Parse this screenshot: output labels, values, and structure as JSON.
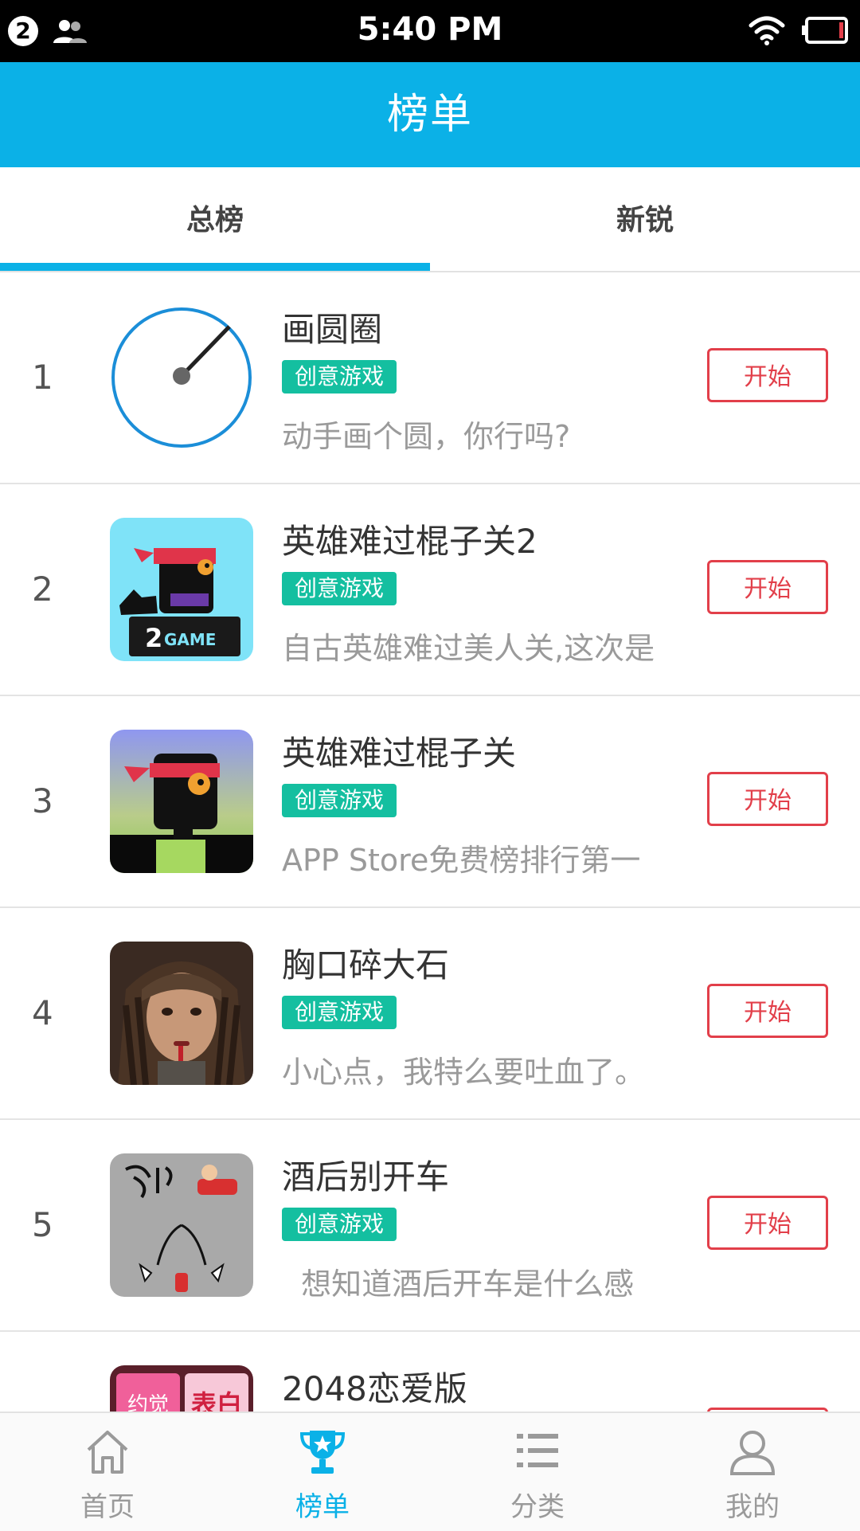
{
  "status_bar": {
    "notification_count": "2",
    "time": "5:40 PM"
  },
  "header": {
    "title": "榜单"
  },
  "tabs": [
    {
      "label": "总榜",
      "selected": true
    },
    {
      "label": "新锐",
      "selected": false
    }
  ],
  "games": [
    {
      "rank": "1",
      "title": "画圆圈",
      "tag": "创意游戏",
      "desc": "动手画个圆，你行吗?",
      "button": "开始",
      "icon": "circle-clock-icon"
    },
    {
      "rank": "2",
      "title": "英雄难过棍子关2",
      "tag": "创意游戏",
      "desc": "自古英雄难过美人关,这次是",
      "button": "开始",
      "icon": "ninja-2game-icon"
    },
    {
      "rank": "3",
      "title": "英雄难过棍子关",
      "tag": "创意游戏",
      "desc": "APP Store免费榜排行第一",
      "button": "开始",
      "icon": "ninja-icon"
    },
    {
      "rank": "4",
      "title": "胸口碎大石",
      "tag": "创意游戏",
      "desc": "小心点，我特么要吐血了。",
      "button": "开始",
      "icon": "face-portrait-icon"
    },
    {
      "rank": "5",
      "title": "酒后别开车",
      "tag": "创意游戏",
      "desc": "  想知道酒后开车是什么感",
      "button": "开始",
      "icon": "drunk-driving-icon"
    },
    {
      "rank": "",
      "title": "2048恋爱版",
      "tag": "",
      "desc": "",
      "button": "",
      "icon": "2048-love-icon",
      "icon_labels": [
        "约觉",
        "表白"
      ]
    }
  ],
  "bottom_nav": [
    {
      "label": "首页",
      "icon": "home-icon",
      "active": false
    },
    {
      "label": "榜单",
      "icon": "trophy-icon",
      "active": true
    },
    {
      "label": "分类",
      "icon": "list-icon",
      "active": false
    },
    {
      "label": "我的",
      "icon": "user-icon",
      "active": false
    }
  ],
  "colors": {
    "primary": "#0bb1e7",
    "tag_green": "#14bfa0",
    "button_red": "#e23f4a"
  }
}
